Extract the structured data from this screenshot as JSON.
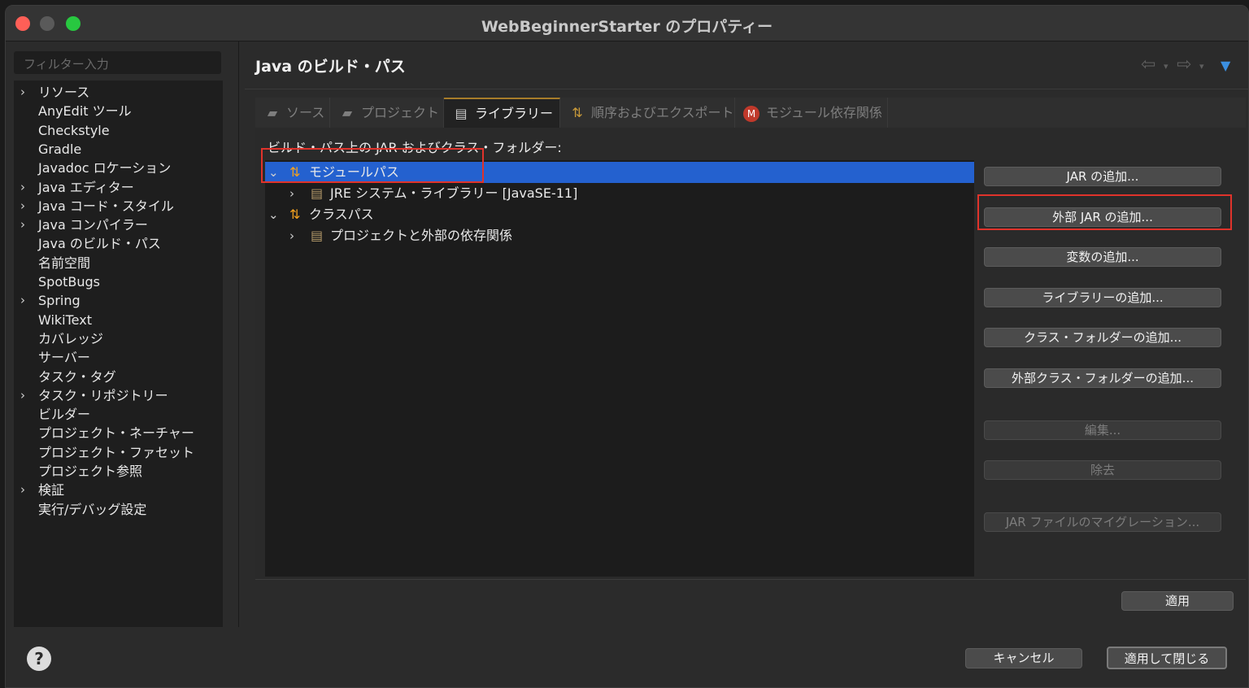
{
  "window": {
    "title": "WebBeginnerStarter のプロパティー"
  },
  "sidebar": {
    "filter_placeholder": "フィルター入力",
    "items": [
      {
        "label": "リソース",
        "expandable": true
      },
      {
        "label": "AnyEdit ツール",
        "expandable": false
      },
      {
        "label": "Checkstyle",
        "expandable": false
      },
      {
        "label": "Gradle",
        "expandable": false
      },
      {
        "label": "Javadoc ロケーション",
        "expandable": false
      },
      {
        "label": "Java エディター",
        "expandable": true
      },
      {
        "label": "Java コード・スタイル",
        "expandable": true
      },
      {
        "label": "Java コンパイラー",
        "expandable": true
      },
      {
        "label": "Java のビルド・パス",
        "expandable": false
      },
      {
        "label": "名前空間",
        "expandable": false
      },
      {
        "label": "SpotBugs",
        "expandable": false
      },
      {
        "label": "Spring",
        "expandable": true
      },
      {
        "label": "WikiText",
        "expandable": false
      },
      {
        "label": "カバレッジ",
        "expandable": false
      },
      {
        "label": "サーバー",
        "expandable": false
      },
      {
        "label": "タスク・タグ",
        "expandable": false
      },
      {
        "label": "タスク・リポジトリー",
        "expandable": true
      },
      {
        "label": "ビルダー",
        "expandable": false
      },
      {
        "label": "プロジェクト・ネーチャー",
        "expandable": false
      },
      {
        "label": "プロジェクト・ファセット",
        "expandable": false
      },
      {
        "label": "プロジェクト参照",
        "expandable": false
      },
      {
        "label": "検証",
        "expandable": true
      },
      {
        "label": "実行/デバッグ設定",
        "expandable": false
      }
    ]
  },
  "main": {
    "title": "Java のビルド・パス",
    "tabs": [
      {
        "label": "ソース",
        "icon": "source-folder-icon",
        "active": false
      },
      {
        "label": "プロジェクト",
        "icon": "project-folder-icon",
        "active": false
      },
      {
        "label": "ライブラリー",
        "icon": "library-icon",
        "active": true
      },
      {
        "label": "順序およびエクスポート",
        "icon": "order-export-icon",
        "active": false
      },
      {
        "label": "モジュール依存関係",
        "icon": "module-icon",
        "active": false
      }
    ],
    "module_badge": "M",
    "panel_label": "ビルド・パス上の JAR およびクラス・フォルダー:",
    "tree": [
      {
        "label": "モジュールパス",
        "level": 0,
        "expanded": true,
        "selected": true,
        "icon": "path-icon"
      },
      {
        "label": "JRE システム・ライブラリー [JavaSE-11]",
        "level": 1,
        "expanded": false,
        "selected": false,
        "icon": "library-icon"
      },
      {
        "label": "クラスパス",
        "level": 0,
        "expanded": true,
        "selected": false,
        "icon": "path-icon"
      },
      {
        "label": "プロジェクトと外部の依存関係",
        "level": 1,
        "expanded": false,
        "selected": false,
        "icon": "library-icon"
      }
    ],
    "buttons": {
      "add_jar": "JAR の追加...",
      "add_external_jar": "外部 JAR の追加...",
      "add_variable": "変数の追加...",
      "add_library": "ライブラリーの追加...",
      "add_class_folder": "クラス・フォルダーの追加...",
      "add_external_class_folder": "外部クラス・フォルダーの追加...",
      "edit": "編集...",
      "remove": "除去",
      "migrate_jar": "JAR ファイルのマイグレーション..."
    },
    "apply": "適用"
  },
  "footer": {
    "cancel": "キャンセル",
    "apply_and_close": "適用して閉じる",
    "help": "?"
  },
  "colors": {
    "selection": "#2461cf",
    "highlight_box": "#e0332b",
    "tab_accent": "#a77c2a"
  }
}
